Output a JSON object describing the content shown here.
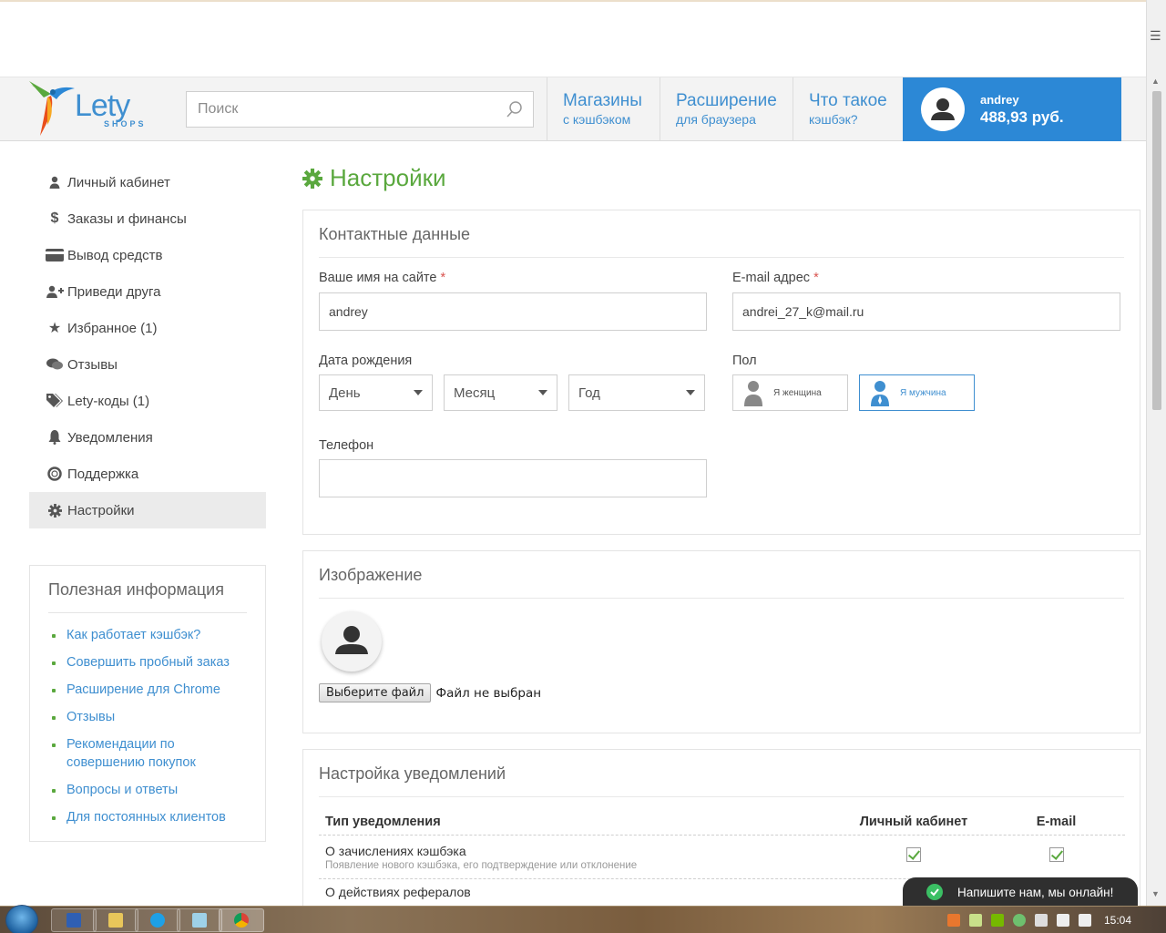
{
  "header": {
    "logo_text": "Lety",
    "logo_sub": "SHOPS",
    "search_placeholder": "Поиск",
    "nav": [
      {
        "line1": "Магазины",
        "line2": "с кэшбэком"
      },
      {
        "line1": "Расширение",
        "line2": "для браузера"
      },
      {
        "line1": "Что такое",
        "line2": "кэшбэк?"
      }
    ],
    "user": {
      "name": "andrey",
      "balance": "488,93 руб."
    }
  },
  "sidebar": {
    "items": [
      {
        "label": "Личный кабинет",
        "icon": "user-icon"
      },
      {
        "label": "Заказы и финансы",
        "icon": "dollar-icon"
      },
      {
        "label": "Вывод средств",
        "icon": "credit-card-icon"
      },
      {
        "label": "Приведи друга",
        "icon": "add-user-icon"
      },
      {
        "label": "Избранное (1)",
        "icon": "star-icon"
      },
      {
        "label": "Отзывы",
        "icon": "comments-icon"
      },
      {
        "label": "Lety-коды (1)",
        "icon": "tags-icon"
      },
      {
        "label": "Уведомления",
        "icon": "bell-icon"
      },
      {
        "label": "Поддержка",
        "icon": "lifebuoy-icon"
      },
      {
        "label": "Настройки",
        "icon": "gear-icon"
      }
    ],
    "active_index": 9
  },
  "info": {
    "title": "Полезная информация",
    "links": [
      "Как работает кэшбэк?",
      "Совершить пробный заказ",
      "Расширение для Chrome",
      "Отзывы",
      "Рекомендации по совершению покупок",
      "Вопросы и ответы",
      "Для постоянных клиентов"
    ]
  },
  "page": {
    "title": "Настройки"
  },
  "contact": {
    "title": "Контактные данные",
    "name_label": "Ваше имя на сайте",
    "name_value": "andrey",
    "email_label": "E-mail адрес",
    "email_value": "andrei_27_k@mail.ru",
    "required_mark": "*",
    "birth_label": "Дата рождения",
    "day": "День",
    "month": "Месяц",
    "year": "Год",
    "gender_label": "Пол",
    "female": "Я женщина",
    "male": "Я мужчина",
    "phone_label": "Телефон",
    "phone_value": ""
  },
  "image": {
    "title": "Изображение",
    "file_button": "Выберите файл",
    "file_status": "Файл не выбран"
  },
  "notifications": {
    "title": "Настройка уведомлений",
    "col_type": "Тип уведомления",
    "col_cabinet": "Личный кабинет",
    "col_email": "E-mail",
    "rows": [
      {
        "title": "О зачислениях кэшбэка",
        "desc": "Появление нового кэшбэка, его подтверждение или отклонение"
      },
      {
        "title": "О действиях рефералов",
        "desc": ""
      }
    ]
  },
  "chat": {
    "label": "Напишите нам, мы онлайн!"
  },
  "taskbar": {
    "time": "15:04"
  },
  "colors": {
    "brand_green": "#5aa83e",
    "brand_blue": "#2c88d6",
    "link_blue": "#3f8fd0"
  }
}
